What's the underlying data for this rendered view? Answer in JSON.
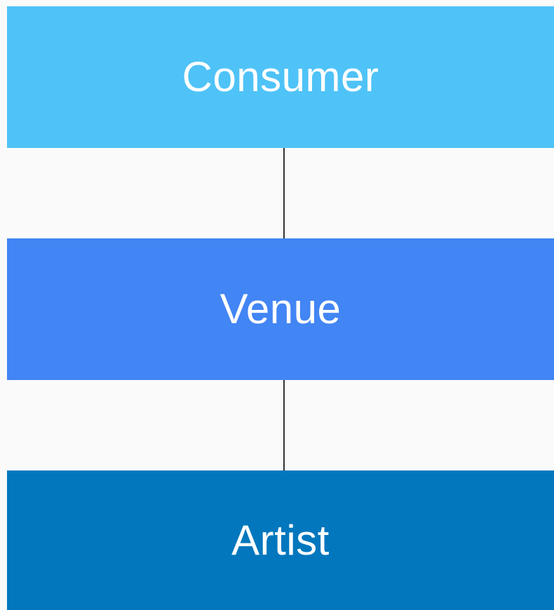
{
  "nodes": [
    {
      "label": "Consumer",
      "color": "#4fc3f7"
    },
    {
      "label": "Venue",
      "color": "#4285f4"
    },
    {
      "label": "Artist",
      "color": "#0277bd"
    }
  ],
  "colors": {
    "background": "#fafafa",
    "connector": "#333333",
    "text": "#ffffff"
  }
}
